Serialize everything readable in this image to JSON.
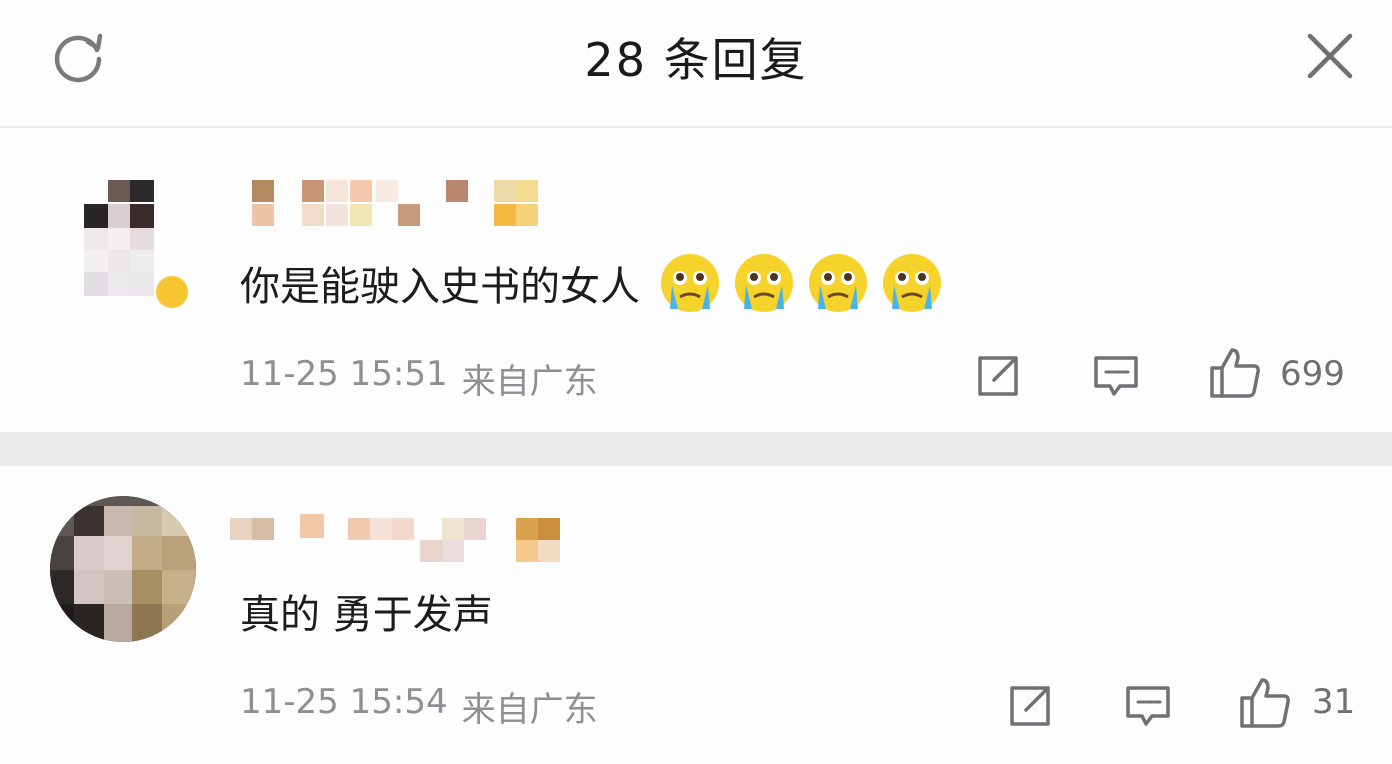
{
  "header": {
    "title": "28 条回复",
    "refresh_icon": "refresh-icon",
    "close_icon": "close-icon"
  },
  "comments": [
    {
      "text": "你是能驶入史书的女人",
      "emoji": [
        "crying-face-emoji",
        "crying-face-emoji",
        "crying-face-emoji",
        "crying-face-emoji"
      ],
      "time": "11-25 15:51",
      "location": "来自广东",
      "likes": "699"
    },
    {
      "text": "真的 勇于发声",
      "emoji": [],
      "time": "11-25 15:54",
      "location": "来自广东",
      "likes": "31"
    }
  ],
  "colors": {
    "background": "#fdfdfe",
    "divider": "#ebebee",
    "meta_text": "#8e8e93",
    "emoji_yellow": "#f6d32a"
  }
}
